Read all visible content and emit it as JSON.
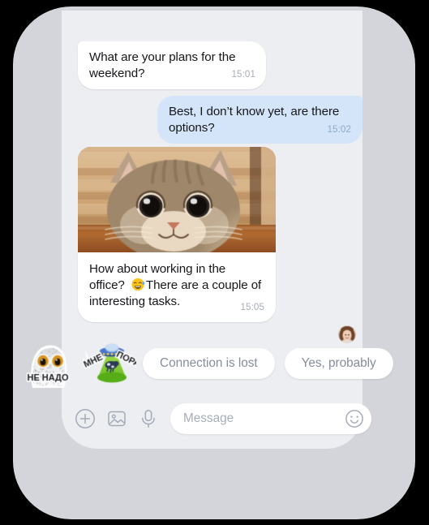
{
  "theme": {
    "page_background": "#000000",
    "frame_color": "#d3d5da",
    "screen_background": "#eceef1",
    "incoming_bubble": "#ffffff",
    "outgoing_bubble": "#d4e5fa",
    "incoming_text": "#16171a",
    "outgoing_text": "#16171a",
    "timestamp_incoming": "#a7adb6",
    "timestamp_outgoing": "#8fa9c6",
    "quick_reply_text": "#868e9c",
    "placeholder_text": "#a8aeb8",
    "icon_color": "#a4abb6"
  },
  "messages": [
    {
      "id": "plans",
      "direction": "incoming",
      "text": "What are your plans for the weekend?",
      "time": "15:01"
    },
    {
      "id": "options",
      "direction": "outgoing",
      "text": "Best, I don’t know yet, are there options?",
      "time": "15:02"
    },
    {
      "id": "photo",
      "direction": "incoming",
      "type": "image",
      "alt": "photo of a tabby cat peeking over a wooden table"
    },
    {
      "id": "office",
      "direction": "incoming",
      "text_before_emoji": "How about working in the office? ",
      "emoji": "grinning-face-with-sweat",
      "text_after_emoji": "There are a couple of interesting tasks.",
      "time": "15:05"
    }
  ],
  "read_receipt": {
    "avatar_name": "contact-avatar",
    "alt": "small round photo avatar of a woman"
  },
  "sticker_suggestions": [
    {
      "name": "owl-sticker",
      "caption": "НЕ НАДО",
      "alt": "snowy owl sticker"
    },
    {
      "name": "ufo-sticker",
      "caption_left": "МНЕ",
      "caption_right": "ПОРА",
      "alt": "UFO abducting a cow sticker"
    }
  ],
  "quick_replies": [
    {
      "label": "Connection is lost"
    },
    {
      "label": "Yes, probably"
    }
  ],
  "composer": {
    "placeholder": "Message",
    "value": "",
    "icons": [
      {
        "name": "plus-circle-icon",
        "label": "Add attachment"
      },
      {
        "name": "image-icon",
        "label": "Send photo"
      },
      {
        "name": "microphone-icon",
        "label": "Record voice message"
      },
      {
        "name": "emoji-smiley-icon",
        "label": "Open emoji picker"
      }
    ]
  }
}
